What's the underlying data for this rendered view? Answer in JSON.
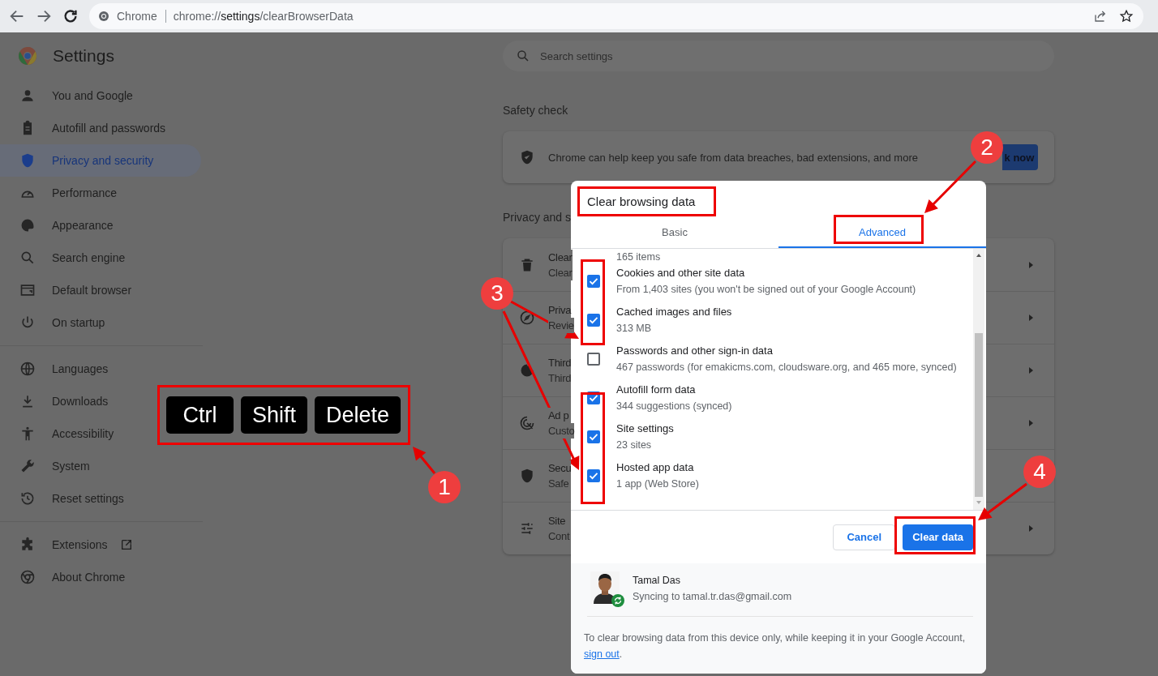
{
  "omnibox": {
    "site_label": "Chrome",
    "url_scheme": "chrome://",
    "url_host": "settings",
    "url_path": "/clearBrowserData"
  },
  "settings": {
    "title": "Settings",
    "search": {
      "placeholder": "Search settings"
    }
  },
  "sidebar": {
    "groups": [
      {
        "items": [
          {
            "label": "You and Google",
            "selected": false
          },
          {
            "label": "Autofill and passwords",
            "selected": false
          },
          {
            "label": "Privacy and security",
            "selected": true
          },
          {
            "label": "Performance",
            "selected": false
          },
          {
            "label": "Appearance",
            "selected": false
          },
          {
            "label": "Search engine",
            "selected": false
          },
          {
            "label": "Default browser",
            "selected": false
          },
          {
            "label": "On startup",
            "selected": false
          }
        ]
      },
      {
        "items": [
          {
            "label": "Languages",
            "selected": false
          },
          {
            "label": "Downloads",
            "selected": false
          },
          {
            "label": "Accessibility",
            "selected": false
          },
          {
            "label": "System",
            "selected": false
          },
          {
            "label": "Reset settings",
            "selected": false
          }
        ]
      },
      {
        "items": [
          {
            "label": "Extensions",
            "selected": false
          },
          {
            "label": "About Chrome",
            "selected": false
          }
        ]
      }
    ]
  },
  "safety_check": {
    "heading": "Safety check",
    "text": "Chrome can help keep you safe from data breaches, bad extensions, and more",
    "button": "k now"
  },
  "privacy": {
    "heading": "Privacy and s",
    "rows": [
      {
        "title": "Clear",
        "subtitle": "Clear"
      },
      {
        "title": "Priva",
        "subtitle": "Revie"
      },
      {
        "title": "Third",
        "subtitle": "Third"
      },
      {
        "title": "Ad p",
        "subtitle": "Custo"
      },
      {
        "title": "Secu",
        "subtitle": "Safe"
      },
      {
        "title": "Site",
        "subtitle": "Cont"
      }
    ]
  },
  "dialog": {
    "title": "Clear browsing data",
    "tabs": [
      {
        "label": "Basic",
        "selected": false
      },
      {
        "label": "Advanced",
        "selected": true
      }
    ],
    "overflow_text": "165 items",
    "options": [
      {
        "label": "Cookies and other site data",
        "detail": "From 1,403 sites (you won't be signed out of your Google Account)",
        "checked": true
      },
      {
        "label": "Cached images and files",
        "detail": "313 MB",
        "checked": true
      },
      {
        "label": "Passwords and other sign-in data",
        "detail": "467 passwords (for emakicms.com, cloudsware.org, and 465 more, synced)",
        "checked": false
      },
      {
        "label": "Autofill form data",
        "detail": "344 suggestions (synced)",
        "checked": true
      },
      {
        "label": "Site settings",
        "detail": "23 sites",
        "checked": true
      },
      {
        "label": "Hosted app data",
        "detail": "1 app (Web Store)",
        "checked": true
      }
    ],
    "buttons": [
      {
        "label": "Cancel",
        "kind": "secondary"
      },
      {
        "label": "Clear data",
        "kind": "primary"
      }
    ],
    "account": {
      "name": "Tamal Das",
      "email": "Syncing to tamal.tr.das@gmail.com"
    },
    "note": "To clear browsing data from this device only, while keeping it in your Google Account, ",
    "note_link": "sign out",
    "note_end": "."
  },
  "annotations": {
    "keys": [
      "Ctrl",
      "Shift",
      "Delete"
    ],
    "steps": [
      "1",
      "2",
      "3",
      "4"
    ]
  }
}
